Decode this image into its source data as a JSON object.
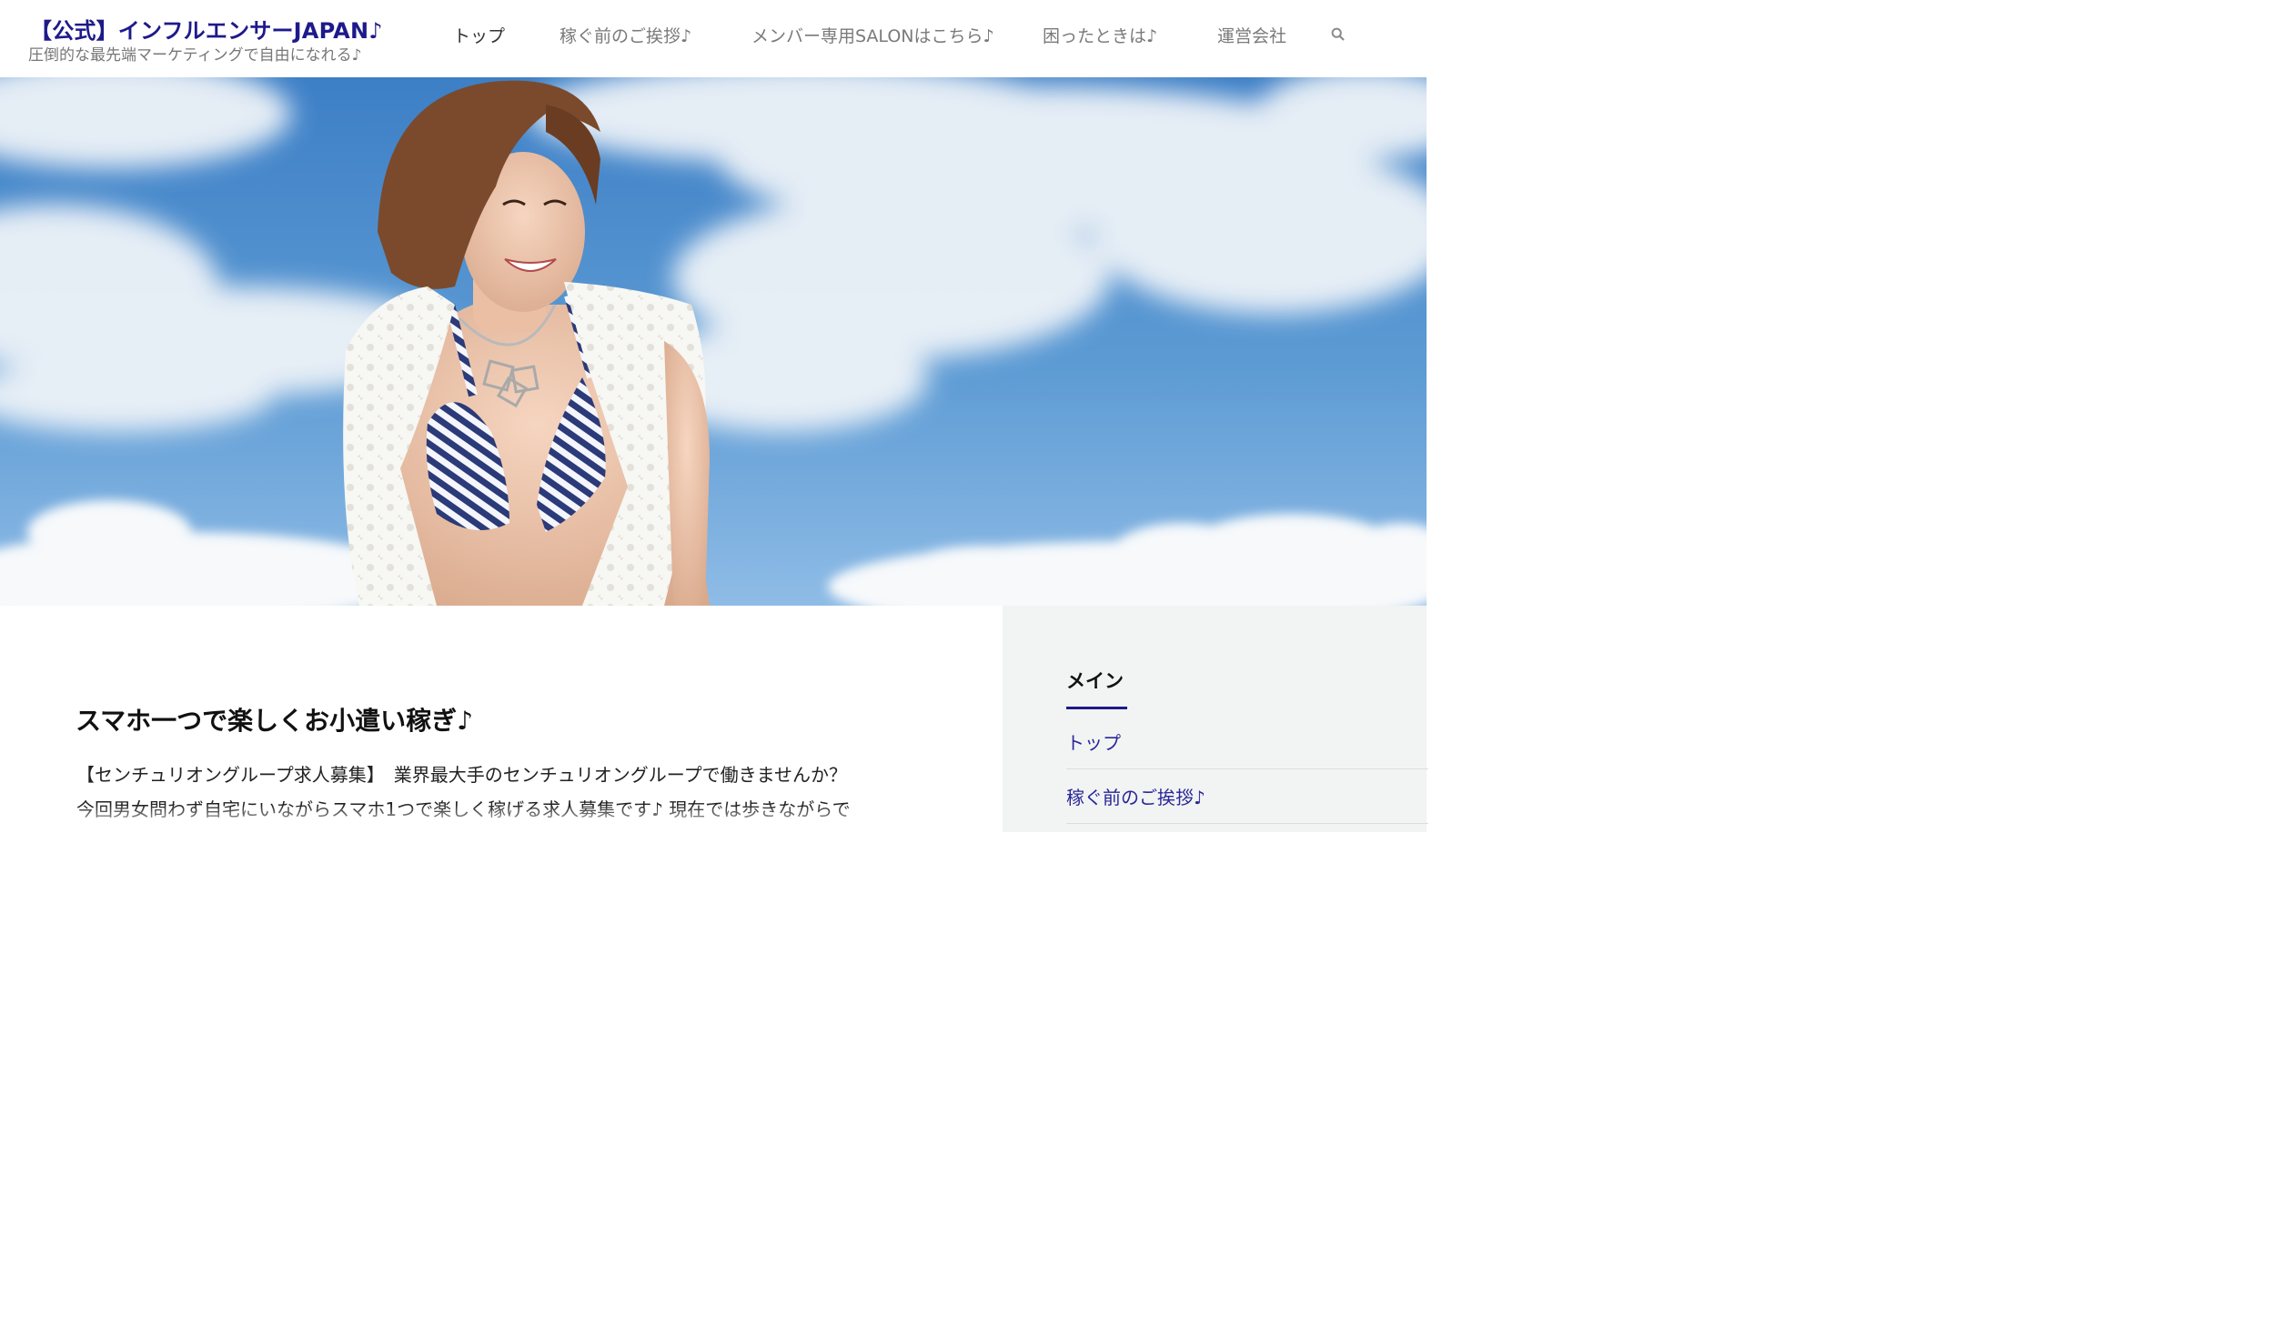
{
  "header": {
    "site_title": "【公式】インフルエンサーJAPAN♪",
    "tagline": "圧倒的な最先端マーケティングで自由になれる♪"
  },
  "nav": {
    "items": [
      {
        "label": "トップ"
      },
      {
        "label": "稼ぐ前のご挨拶♪"
      },
      {
        "label": "メンバー専用SALONはこちら♪"
      },
      {
        "label": "困ったときは♪"
      },
      {
        "label": "運営会社"
      }
    ],
    "search_icon": "search-icon"
  },
  "post": {
    "title": "スマホ一つで楽しくお小遣い稼ぎ♪",
    "lines": [
      "【センチュリオングループ求人募集】　業界最大手のセンチュリオングループで働きませんか？",
      "今回男女問わず自宅にいながらスマホ1つで楽しく稼げる求人募集です♪ 現在では歩きながらで"
    ]
  },
  "sidebar": {
    "widget_title": "メイン",
    "links": [
      {
        "label": "トップ"
      },
      {
        "label": "稼ぐ前のご挨拶♪"
      }
    ]
  },
  "colors": {
    "brand": "#1e1a8a",
    "link": "#2a2699",
    "sidebar_bg": "#f1f4f3",
    "sky": "#5a9bd3"
  }
}
